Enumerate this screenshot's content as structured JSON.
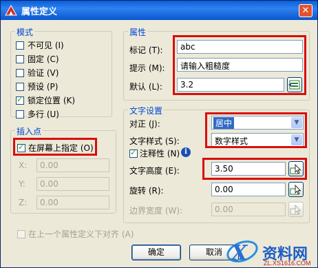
{
  "window": {
    "title": "属性定义",
    "close_glyph": "✕"
  },
  "mode": {
    "legend": "模式",
    "items": [
      {
        "label": "不可见 (I)",
        "checked": false
      },
      {
        "label": "固定 (C)",
        "checked": false
      },
      {
        "label": "验证 (V)",
        "checked": false
      },
      {
        "label": "预设 (P)",
        "checked": false
      },
      {
        "label": "锁定位置 (K)",
        "checked": true
      },
      {
        "label": "多行 (U)",
        "checked": false
      }
    ]
  },
  "insertion": {
    "legend": "插入点",
    "on_screen_label": "在屏幕上指定 (O)",
    "on_screen_checked": true,
    "x_label": "X:",
    "x_value": "0.00",
    "y_label": "Y:",
    "y_value": "0.00",
    "z_label": "Z:",
    "z_value": "0.00"
  },
  "attribute": {
    "legend": "属性",
    "tag_label": "标记 (T):",
    "tag_value": "abc",
    "prompt_label": "提示 (M):",
    "prompt_value": "请输入粗糙度",
    "default_label": "默认 (L):",
    "default_value": "3.2"
  },
  "text_settings": {
    "legend": "文字设置",
    "justify_label": "对正 (J):",
    "justify_value": "居中",
    "style_label": "文字样式 (S):",
    "style_value": "数字样式",
    "annotative_label": "注释性 (N)",
    "annotative_checked": true,
    "height_label": "文字高度 (E):",
    "height_value": "3.50",
    "rotation_label": "旋转 (R):",
    "rotation_value": "0.00",
    "boundary_label": "边界宽度 (W):",
    "boundary_value": "0.00"
  },
  "align_below_label": "在上一个属性定义下对齐 (A)",
  "buttons": {
    "ok": "确定",
    "cancel": "取消"
  },
  "watermark": {
    "brand": "资料网",
    "url": "ZL.XS1616.COM"
  },
  "colors": {
    "highlight_box": "#d90d0d",
    "title_bar": "#0a5fd8",
    "group_legend": "#0046d5"
  }
}
